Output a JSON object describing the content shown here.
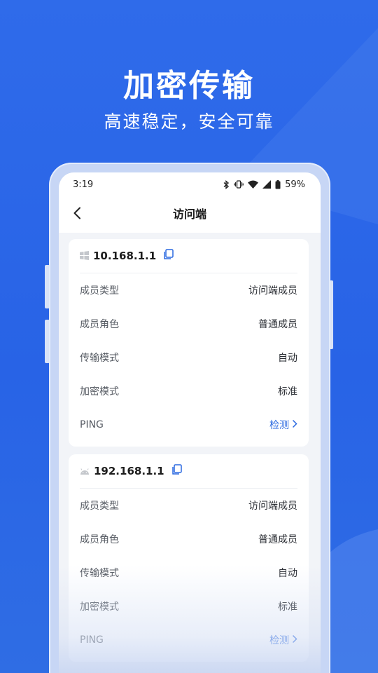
{
  "hero": {
    "title": "加密传输",
    "subtitle": "高速稳定，安全可靠"
  },
  "status_bar": {
    "time": "3:19",
    "battery": "59%",
    "icons": [
      "bluetooth-icon",
      "vibrate-icon",
      "wifi-icon",
      "signal-icon",
      "battery-icon"
    ]
  },
  "nav": {
    "title": "访问端",
    "back_icon": "chevron-left-icon"
  },
  "cards": [
    {
      "os_icon": "windows-icon",
      "ip": "10.168.1.1",
      "rows": [
        {
          "label": "成员类型",
          "value": "访问端成员"
        },
        {
          "label": "成员角色",
          "value": "普通成员"
        },
        {
          "label": "传输模式",
          "value": "自动"
        },
        {
          "label": "加密模式",
          "value": "标准"
        },
        {
          "label": "PING",
          "value": "检测"
        }
      ]
    },
    {
      "os_icon": "android-icon",
      "ip": "192.168.1.1",
      "rows": [
        {
          "label": "成员类型",
          "value": "访问端成员"
        },
        {
          "label": "成员角色",
          "value": "普通成员"
        },
        {
          "label": "传输模式",
          "value": "自动"
        },
        {
          "label": "加密模式",
          "value": "标准"
        },
        {
          "label": "PING",
          "value": "检测"
        }
      ]
    }
  ],
  "colors": {
    "background": "#2863e6",
    "link": "#2a68e0",
    "card": "#ffffff"
  }
}
